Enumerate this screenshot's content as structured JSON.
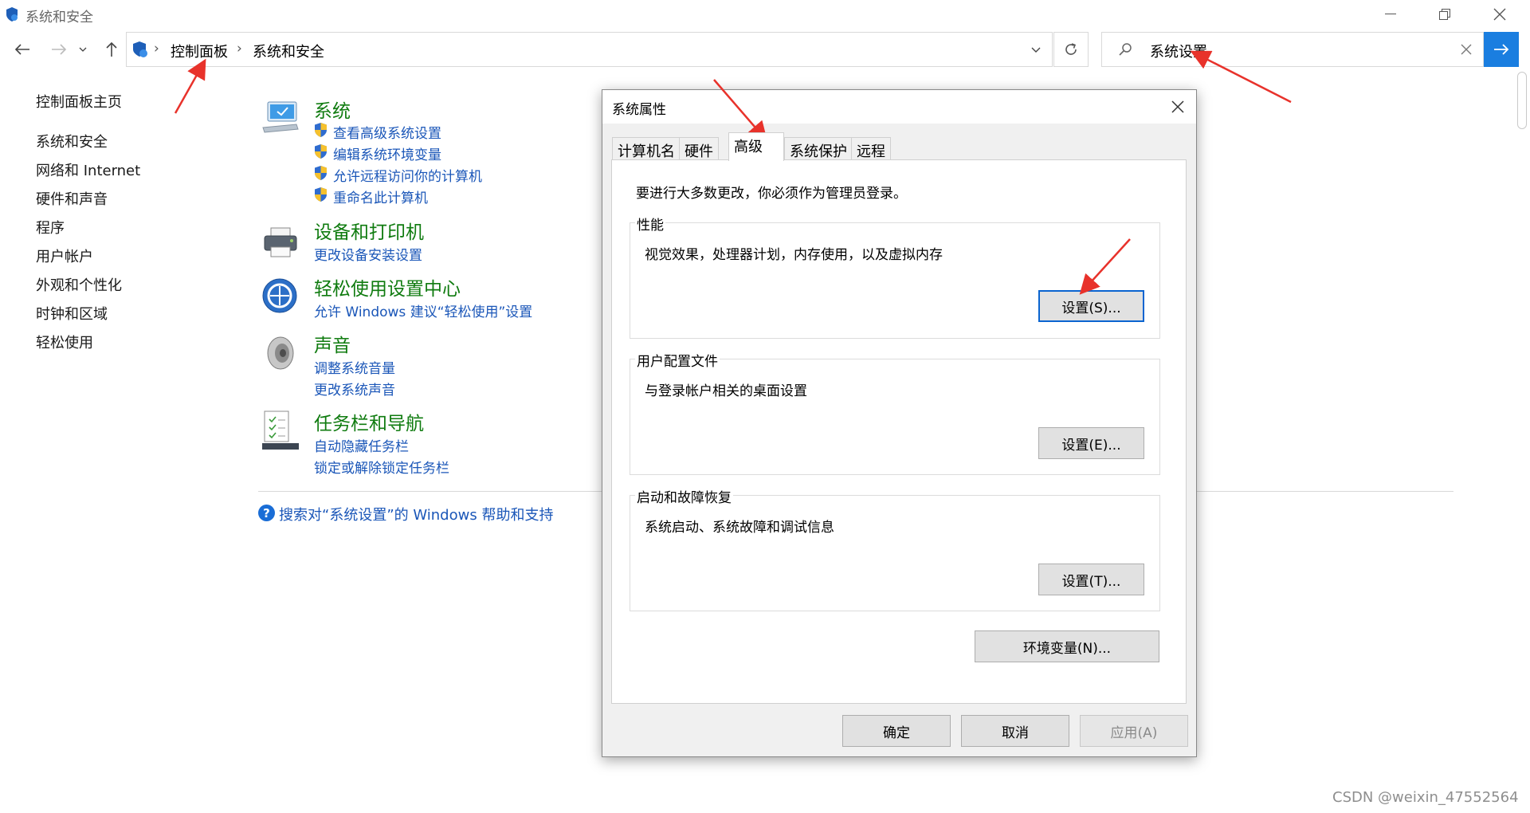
{
  "window": {
    "title": "系统和安全"
  },
  "address": {
    "crumbs": [
      "控制面板",
      "系统和安全"
    ]
  },
  "search": {
    "value": "系统设置"
  },
  "sidebar": {
    "home": "控制面板主页",
    "items": [
      "系统和安全",
      "网络和 Internet",
      "硬件和声音",
      "程序",
      "用户帐户",
      "外观和个性化",
      "时钟和区域",
      "轻松使用"
    ]
  },
  "categories": [
    {
      "title": "系统",
      "icon": "computer-monitor-icon",
      "links": [
        "查看高级系统设置",
        "编辑系统环境变量",
        "允许远程访问你的计算机",
        "重命名此计算机"
      ]
    },
    {
      "title": "设备和打印机",
      "icon": "printer-icon",
      "links": [
        "更改设备安装设置"
      ]
    },
    {
      "title": "轻松使用设置中心",
      "icon": "ease-of-access-icon",
      "links": [
        "允许 Windows 建议“轻松使用”设置"
      ]
    },
    {
      "title": "声音",
      "icon": "speaker-icon",
      "links": [
        "调整系统音量",
        "更改系统声音"
      ]
    },
    {
      "title": "任务栏和导航",
      "icon": "taskbar-icon",
      "links": [
        "自动隐藏任务栏",
        "锁定或解除锁定任务栏"
      ]
    }
  ],
  "help": {
    "text": "搜索对“系统设置”的 Windows 帮助和支持"
  },
  "dialog": {
    "title": "系统属性",
    "tabs": [
      "计算机名",
      "硬件",
      "高级",
      "系统保护",
      "远程"
    ],
    "active_tab": "高级",
    "admin_note": "要进行大多数更改，你必须作为管理员登录。",
    "groups": [
      {
        "label": "性能",
        "desc": "视觉效果，处理器计划，内存使用，以及虚拟内存",
        "button": "设置(S)..."
      },
      {
        "label": "用户配置文件",
        "desc": "与登录帐户相关的桌面设置",
        "button": "设置(E)..."
      },
      {
        "label": "启动和故障恢复",
        "desc": "系统启动、系统故障和调试信息",
        "button": "设置(T)..."
      }
    ],
    "env_button": "环境变量(N)...",
    "ok": "确定",
    "cancel": "取消",
    "apply": "应用(A)"
  },
  "watermark": "CSDN @weixin_47552564",
  "colors": {
    "category_title": "#0f7b0f",
    "link": "#1a56b8",
    "accent": "#1a7ee0",
    "annotation_arrow": "#e8322b"
  }
}
